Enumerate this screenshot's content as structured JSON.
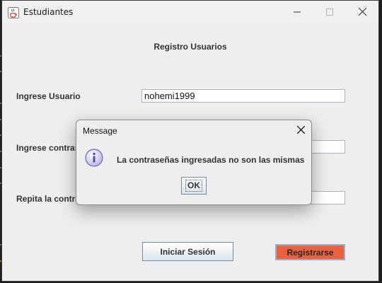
{
  "window": {
    "title": "Estudiantes",
    "icons": {
      "app": "java-cup-icon",
      "minimize": "minimize-icon",
      "maximize": "maximize-icon",
      "close": "close-icon"
    }
  },
  "form": {
    "heading": "Registro Usuarios",
    "username_label": "Ingrese Usuario",
    "username_value": "nohemi1999",
    "password_label": "Ingrese contras",
    "password_value": "",
    "repeat_label": "Repita la contra",
    "repeat_value": "",
    "login_button": "Iniciar Sesión",
    "register_button": "Registrarse",
    "colors": {
      "register_button_bg": "#e8623f"
    }
  },
  "dialog": {
    "title": "Message",
    "message": "La contraseñas ingresadas no son las mismas",
    "ok_label": "OK",
    "icon": "info-icon"
  }
}
